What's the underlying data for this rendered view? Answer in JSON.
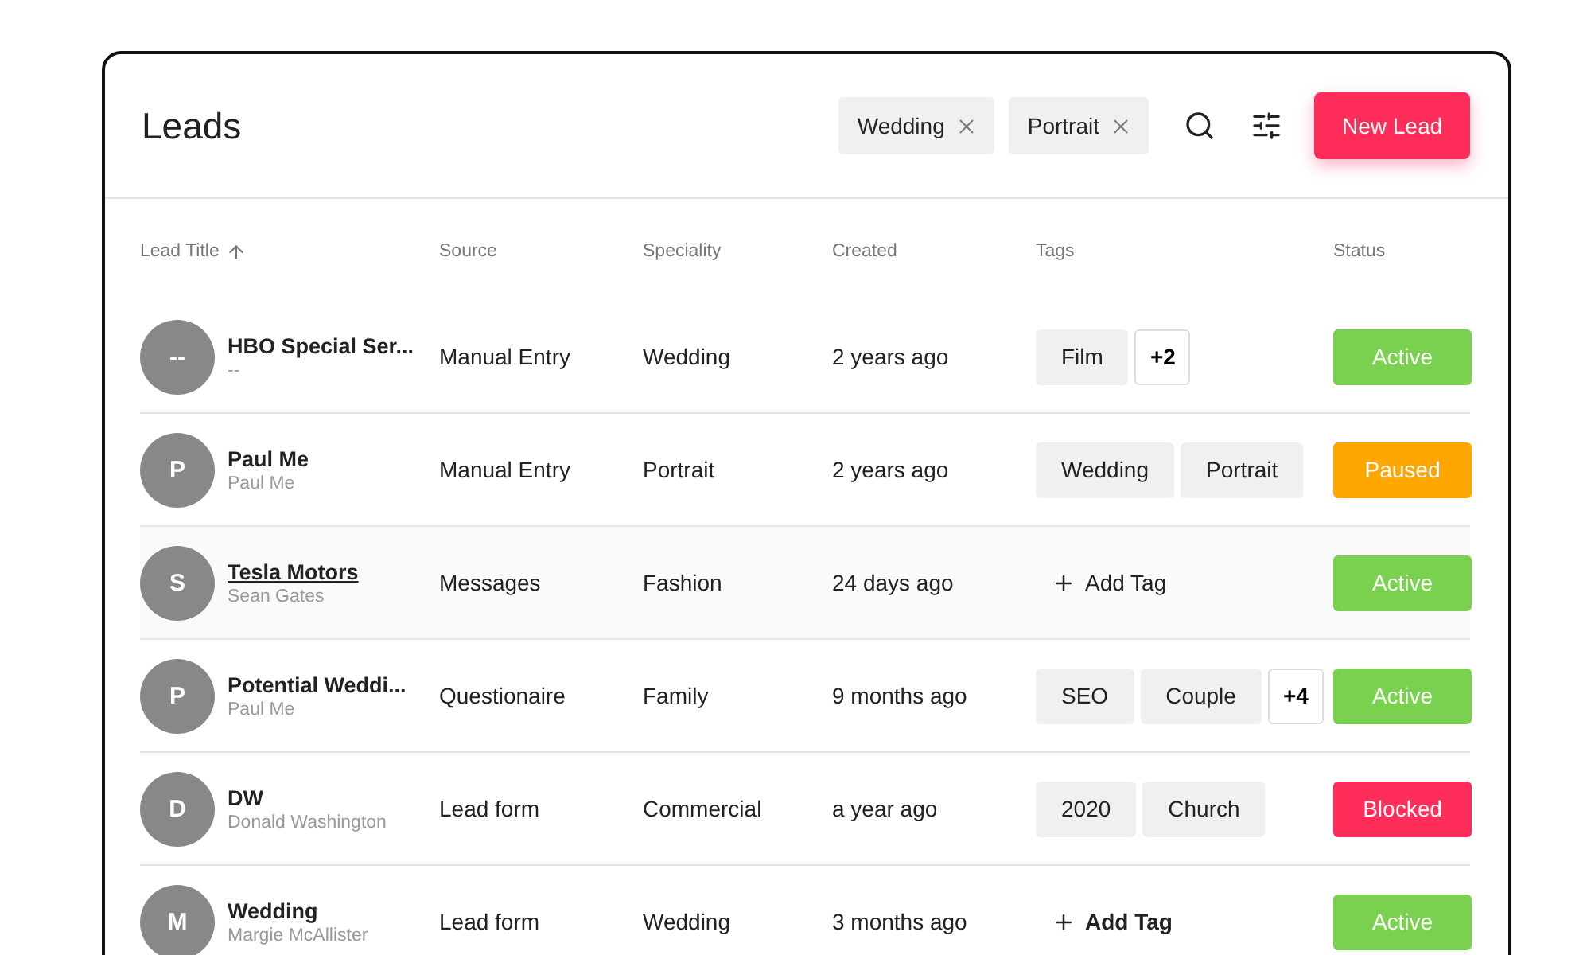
{
  "title": "Leads",
  "filters": [
    {
      "label": "Wedding"
    },
    {
      "label": "Portrait"
    }
  ],
  "new_button": "New Lead",
  "columns": [
    {
      "label": "Lead Title",
      "sorted": true
    },
    {
      "label": "Source",
      "sorted": false
    },
    {
      "label": "Speciality",
      "sorted": false
    },
    {
      "label": "Created",
      "sorted": false
    },
    {
      "label": "Tags",
      "sorted": false
    },
    {
      "label": "Status",
      "sorted": false
    }
  ],
  "rows": [
    {
      "initial": "--",
      "title": "HBO Special Ser...",
      "subtitle": "--",
      "source": "Manual Entry",
      "speciality": "Wedding",
      "created": "2 years ago",
      "tags": [
        "Film"
      ],
      "more": "+2",
      "status": {
        "label": "Active",
        "kind": "active"
      },
      "selected": false
    },
    {
      "initial": "P",
      "title": "Paul Me",
      "subtitle": "Paul Me",
      "source": "Manual Entry",
      "speciality": "Portrait",
      "created": "2 years ago",
      "tags": [
        "Wedding",
        "Portrait"
      ],
      "status": {
        "label": "Paused",
        "kind": "paused"
      },
      "selected": false
    },
    {
      "initial": "S",
      "title": "Tesla Motors",
      "subtitle": "Sean Gates",
      "source": "Messages",
      "speciality": "Fashion",
      "created": "24 days ago",
      "add_tag": {
        "label": "Add Tag",
        "hovered": false
      },
      "status": {
        "label": "Active",
        "kind": "active"
      },
      "selected": true
    },
    {
      "initial": "P",
      "title": "Potential Weddi...",
      "subtitle": "Paul Me",
      "source": "Questionaire",
      "speciality": "Family",
      "created": "9 months ago",
      "tags": [
        "SEO",
        "Couple"
      ],
      "more": "+4",
      "status": {
        "label": "Active",
        "kind": "active"
      },
      "selected": false
    },
    {
      "initial": "D",
      "title": "DW",
      "subtitle": "Donald Washington",
      "source": "Lead form",
      "speciality": "Commercial",
      "created": "a year ago",
      "tags": [
        "2020",
        "Church"
      ],
      "status": {
        "label": "Blocked",
        "kind": "blocked"
      },
      "selected": false
    },
    {
      "initial": "M",
      "title": "Wedding",
      "subtitle": "Margie McAllister",
      "source": "Lead form",
      "speciality": "Wedding",
      "created": "3 months ago",
      "add_tag": {
        "label": "Add Tag",
        "hovered": true
      },
      "status": {
        "label": "Active",
        "kind": "active"
      },
      "selected": false
    }
  ]
}
